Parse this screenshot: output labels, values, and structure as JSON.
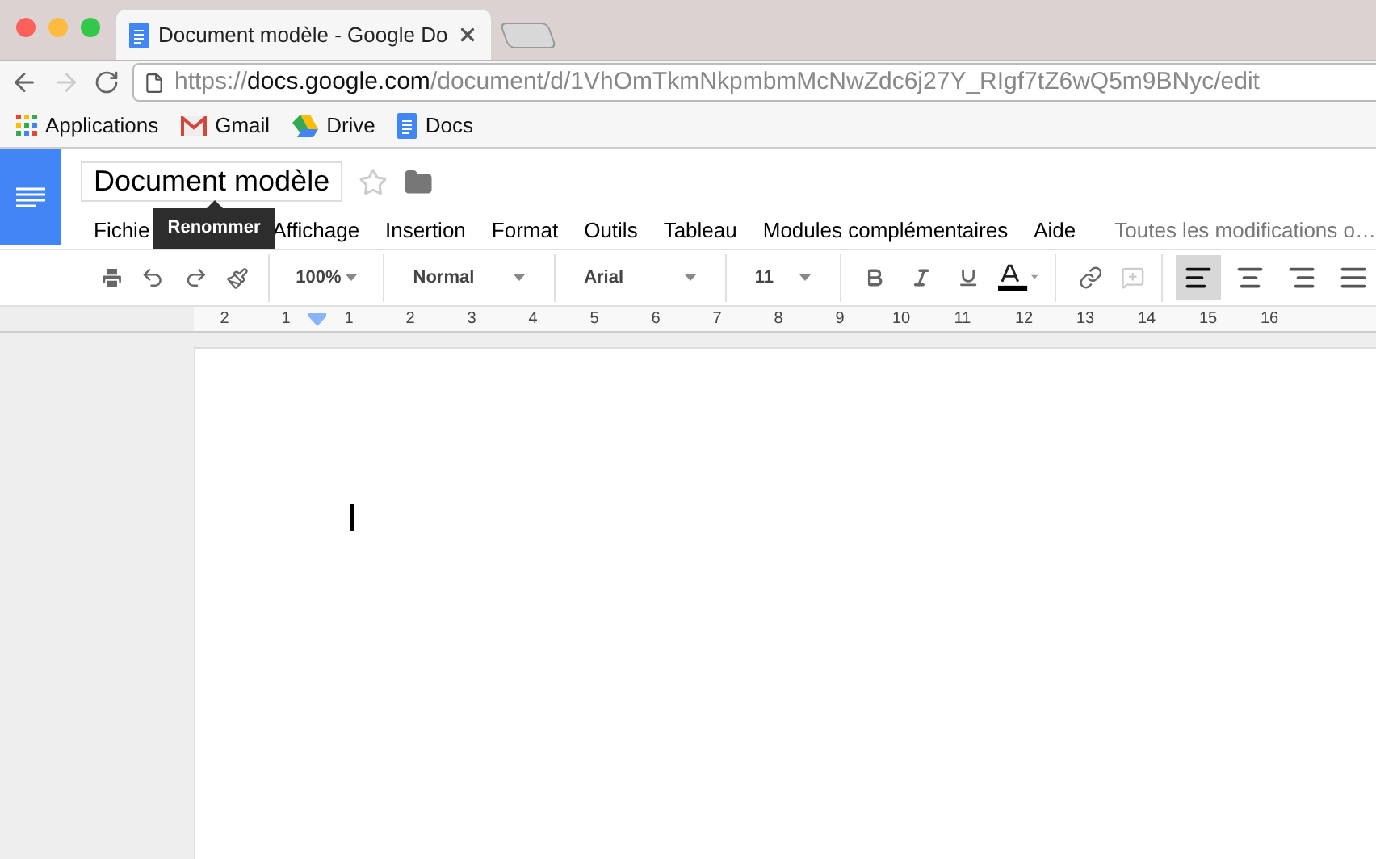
{
  "browser": {
    "tab": {
      "title": "Document modèle - Google Do",
      "selected": true
    },
    "url": {
      "scheme": "https://",
      "host": "docs.google.com",
      "path": "/document/d/1VhOmTkmNkpmbmMcNwZdc6j27Y_RIgf7tZ6wQ5m9BNyc/edit"
    },
    "forward_disabled": true,
    "bookmarks": [
      {
        "kind": "apps",
        "label": "Applications"
      },
      {
        "kind": "gmail",
        "label": "Gmail"
      },
      {
        "kind": "drive",
        "label": "Drive"
      },
      {
        "kind": "docs",
        "label": "Docs"
      }
    ]
  },
  "doc": {
    "title": "Document modèle",
    "starred": false,
    "tooltip": "Renommer",
    "menu": [
      "Fichie",
      "Affichage",
      "Insertion",
      "Format",
      "Outils",
      "Tableau",
      "Modules complémentaires",
      "Aide"
    ],
    "save_status": "Toutes les modifications o…",
    "zoom": "100%",
    "style": "Normal",
    "font": "Arial",
    "size": "11",
    "alignments": [
      {
        "kind": "left",
        "selected": true
      },
      {
        "kind": "center",
        "selected": false
      },
      {
        "kind": "right",
        "selected": false
      },
      {
        "kind": "justify",
        "selected": false
      }
    ],
    "ruler": [
      "2",
      "1",
      "1",
      "2",
      "3",
      "4",
      "5",
      "6",
      "7",
      "8",
      "9",
      "10",
      "11",
      "12",
      "13",
      "14",
      "15",
      "16"
    ]
  }
}
